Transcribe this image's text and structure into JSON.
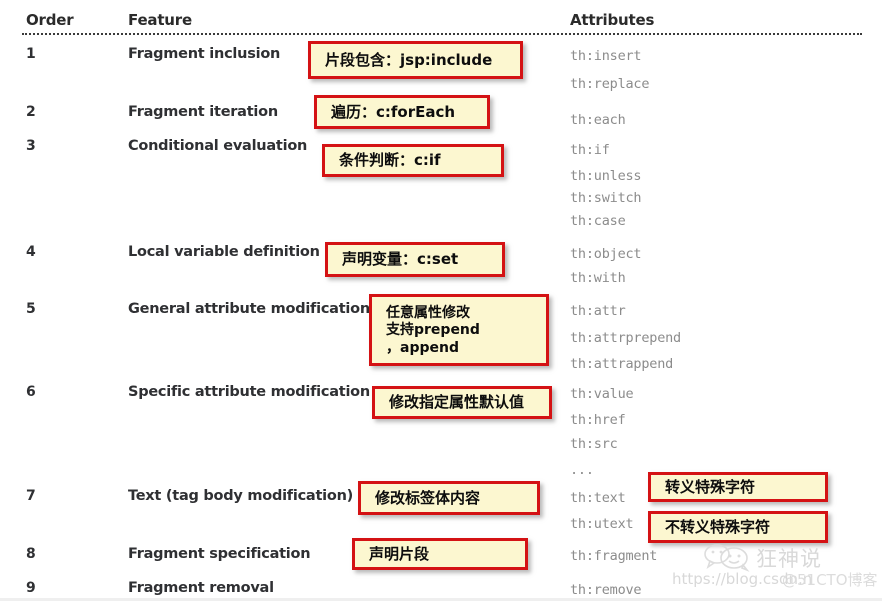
{
  "table": {
    "headers": {
      "order": "Order",
      "feature": "Feature",
      "attributes": "Attributes"
    },
    "rows": [
      {
        "order": "1",
        "feature": "Fragment inclusion",
        "attributes": [
          "th:insert",
          "th:replace"
        ]
      },
      {
        "order": "2",
        "feature": "Fragment iteration",
        "attributes": [
          "th:each"
        ]
      },
      {
        "order": "3",
        "feature": "Conditional evaluation",
        "attributes": [
          "th:if",
          "th:unless",
          "th:switch",
          "th:case"
        ]
      },
      {
        "order": "4",
        "feature": "Local variable definition",
        "attributes": [
          "th:object",
          "th:with"
        ]
      },
      {
        "order": "5",
        "feature": "General attribute modification",
        "attributes": [
          "th:attr",
          "th:attrprepend",
          "th:attrappend"
        ]
      },
      {
        "order": "6",
        "feature": "Specific attribute modification",
        "attributes": [
          "th:value",
          "th:href",
          "th:src",
          "..."
        ]
      },
      {
        "order": "7",
        "feature": "Text (tag body modification)",
        "attributes": [
          "th:text",
          "th:utext"
        ]
      },
      {
        "order": "8",
        "feature": "Fragment specification",
        "attributes": [
          "th:fragment"
        ]
      },
      {
        "order": "9",
        "feature": "Fragment removal",
        "attributes": [
          "th:remove"
        ]
      }
    ]
  },
  "annotations": [
    {
      "id": "annotation-jsp-include",
      "text": "片段包含：jsp:include"
    },
    {
      "id": "annotation-foreach",
      "text": "遍历：c:forEach"
    },
    {
      "id": "annotation-cif",
      "text": "条件判断：c:if"
    },
    {
      "id": "annotation-cset",
      "text": "声明变量：c:set"
    },
    {
      "id": "annotation-attr-modify",
      "text": "任意属性修改\n支持prepend\n，append"
    },
    {
      "id": "annotation-attr-default",
      "text": "修改指定属性默认值"
    },
    {
      "id": "annotation-tag-body",
      "text": "修改标签体内容"
    },
    {
      "id": "annotation-escape",
      "text": "转义特殊字符"
    },
    {
      "id": "annotation-unescape",
      "text": "不转义特殊字符"
    },
    {
      "id": "annotation-declare-fragment",
      "text": "声明片段"
    }
  ],
  "watermark": {
    "url": "https://blog.csdn.n",
    "brand": "狂神说",
    "cto": "@51CTO博客",
    "logo_icon": "wechat-bubble-icon"
  },
  "colors": {
    "callout_fill": "#fcf7d0",
    "callout_border": "#d41214",
    "text": "#2f3033",
    "attribute_text": "#8c8c8c"
  }
}
